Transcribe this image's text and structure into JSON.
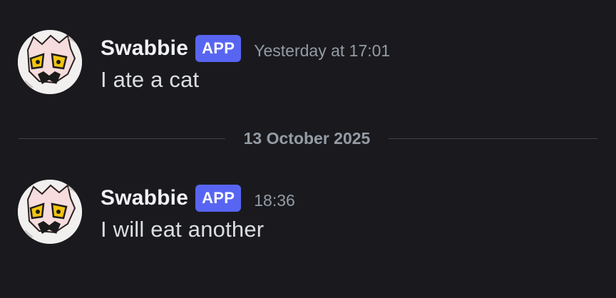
{
  "date_divider": "13 October 2025",
  "messages": [
    {
      "username": "Swabbie",
      "badge": "APP",
      "timestamp": "Yesterday at 17:01",
      "content": "I ate a cat"
    },
    {
      "username": "Swabbie",
      "badge": "APP",
      "timestamp": "18:36",
      "content": "I will eat another"
    }
  ],
  "colors": {
    "background": "#1a1a1e",
    "username": "#f2f3f5",
    "badge_bg": "#5865f2",
    "timestamp": "#949ba4",
    "message_text": "#dbdee1",
    "divider_line": "#3f4147"
  },
  "icons": {
    "avatar": "avatar-drawing-icon"
  }
}
